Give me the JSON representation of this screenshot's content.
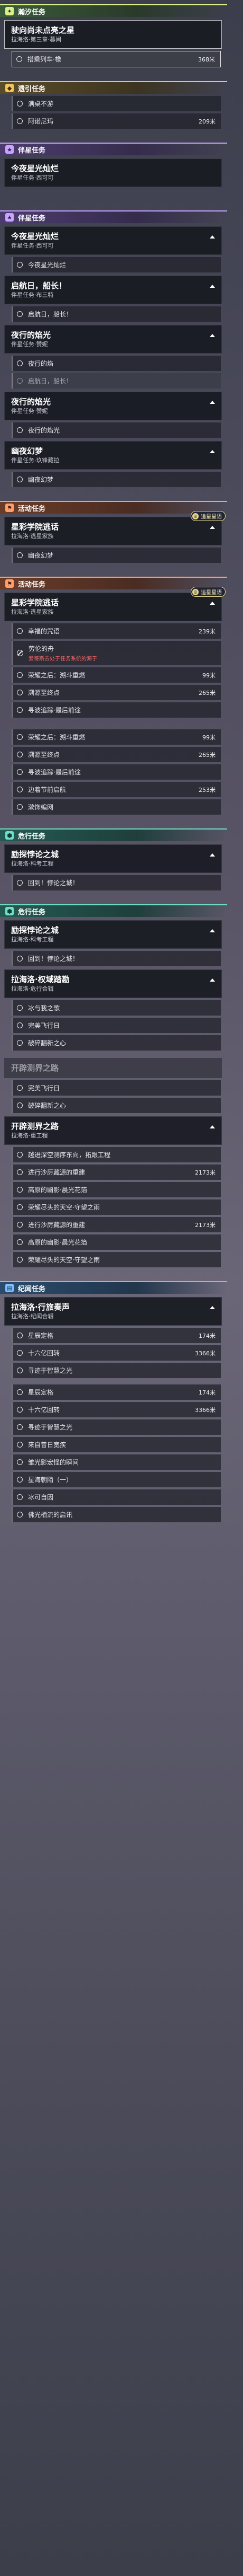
{
  "s0_cat": {
    "label": "瀚汐任务",
    "icon": "spark-icon",
    "accent": "#d9f08c"
  },
  "s0_q0": {
    "title": "驶向尚未点亮之星",
    "sub": "拉海洛·第三章·暮间"
  },
  "s0_q0_t0": {
    "text": "搭乘列车·橡",
    "dist": "368米"
  },
  "s1_cat": {
    "label": "遗引任务",
    "icon": "pin-icon",
    "accent": "#f2c45c"
  },
  "s1_t0": {
    "text": "满桌不游",
    "dist": ""
  },
  "s1_t1": {
    "text": "阿诺尼玛",
    "dist": "209米"
  },
  "s2_cat": {
    "label": "伴星任务",
    "icon": "star-icon",
    "accent": "#c8a4ff"
  },
  "s2_q0": {
    "title": "今夜星光灿烂",
    "sub": "伴星任务·西可可"
  },
  "s3_cat": {
    "label": "伴星任务",
    "icon": "star-icon",
    "accent": "#c8a4ff"
  },
  "s3_q0": {
    "title": "今夜星光灿烂",
    "sub": "伴星任务·西可可"
  },
  "s3_q0_t0": {
    "text": "今夜星光灿烂"
  },
  "s3_q1": {
    "title": "启航日，船长！",
    "sub": "伴星任务·布三特"
  },
  "s3_q1_t0": {
    "text": "启航日，船长！"
  },
  "s3_q2": {
    "title": "夜行的焰光",
    "sub": "伴星任务·赞妮"
  },
  "s3_q2_t0": {
    "text": "夜行的焰"
  },
  "s3_q2_t1": {
    "text": "启航日，船长！"
  },
  "s3_q3": {
    "title": "夜行的焰光",
    "sub": "伴星任务·赞妮"
  },
  "s3_q3_t0": {
    "text": "夜行的焰光"
  },
  "s3_q4": {
    "title": "幽夜幻梦",
    "sub": "伴星任务·玖锋藏拉"
  },
  "s3_q4_t0": {
    "text": "幽夜幻梦"
  },
  "s4_cat": {
    "label": "活动任务",
    "icon": "flag-icon",
    "accent": "#ff9e6a"
  },
  "s4_q0": {
    "title": "星彩学院逃话",
    "sub": "拉海洛·逃星家族",
    "track": "追星星语"
  },
  "s4_q0_t0": {
    "text": "幽夜幻梦"
  },
  "s5_cat": {
    "label": "活动任务",
    "icon": "flag-icon",
    "accent": "#ff9e6a"
  },
  "s5_q0": {
    "title": "星彩学院逃话",
    "sub": "拉海洛·逃星家族",
    "track": "追星星语"
  },
  "s5_q0_t0": {
    "text": "幸福的咒语",
    "dist": "239米"
  },
  "s5_q0_t1": {
    "text": "劳伦的舟",
    "warn": "爱哥斯去处于任务系统的源于"
  },
  "s5_q0_t2": {
    "text": "荣耀之后：溯斗重燃",
    "dist": "99米"
  },
  "s5_q0_t3": {
    "text": "溯源至终点",
    "dist": "265米"
  },
  "s5_q0_t4": {
    "text": "寻波追踪·最后前途"
  },
  "s5_q0_t5": {
    "text": "荣耀之后：溯斗重燃",
    "dist": "99米"
  },
  "s5_q0_t6": {
    "text": "溯源至终点",
    "dist": "265米"
  },
  "s5_q0_t7": {
    "text": "寻波追踪·最后前途"
  },
  "s5_q0_t8": {
    "text": "边着节前启航",
    "dist": "253米"
  },
  "s5_q0_t9": {
    "text": "漱饰编网"
  },
  "s6_cat": {
    "label": "危行任务",
    "icon": "shield-icon",
    "accent": "#6fe0c8"
  },
  "s6_q0": {
    "title": "励探悖论之城",
    "sub": "拉海洛·科考工程"
  },
  "s6_q0_t0": {
    "text": "回到！悖论之城！"
  },
  "s7_cat": {
    "label": "危行任务",
    "icon": "shield-icon",
    "accent": "#6fe0c8"
  },
  "s7_q0": {
    "title": "励探悖论之城",
    "sub": "拉海洛·科考工程"
  },
  "s7_q0_t0": {
    "text": "回到！悖论之城！"
  },
  "s7_q1": {
    "title": "拉海洛·权域踏勘",
    "sub": "拉海洛·危行合辑"
  },
  "s7_q1_t0": {
    "text": "冰与我之歌"
  },
  "s7_q1_t1": {
    "text": "完美飞行日"
  },
  "s7_q1_t2": {
    "text": "破碎翻新之心"
  },
  "s8_q0": {
    "title": "开辟测界之路",
    "sub": ""
  },
  "s8_q0_t0": {
    "text": "完美飞行日"
  },
  "s8_q0_t1": {
    "text": "破碎翻新之心"
  },
  "s8_q1": {
    "title": "开辟测界之路",
    "sub": "拉海洛·重工程"
  },
  "s8_q1_t0": {
    "text": "越进深空测序东向，拓跟工程"
  },
  "s8_q1_t1": {
    "text": "进行沙厉藏源的重建",
    "dist": "2173米"
  },
  "s8_q1_t2": {
    "text": "高原的幽影·晨光花箔"
  },
  "s8_q1_t3": {
    "text": "荣耀尽头的天空·守望之雨"
  },
  "s8_q1_t4": {
    "text": "进行沙厉藏源的重建",
    "dist": "2173米"
  },
  "s8_q1_t5": {
    "text": "高原的幽影·晨光花箔"
  },
  "s8_q1_t6": {
    "text": "荣耀尽头的天空·守望之雨"
  },
  "s9_cat": {
    "label": "纪闻任务",
    "icon": "book-icon",
    "accent": "#7cc0ff"
  },
  "s9_q0": {
    "title": "拉海洛·行旅奏声",
    "sub": "拉海洛·纪闻合辑"
  },
  "s9_q0_t0": {
    "text": "星辰定格",
    "dist": "174米"
  },
  "s9_q0_t1": {
    "text": "十六亿回转",
    "dist": "3366米"
  },
  "s9_q0_t2": {
    "text": "寻迹于智慧之光"
  },
  "s9_q0_t3": {
    "text": "星辰定格",
    "dist": "174米"
  },
  "s9_q0_t4": {
    "text": "十六亿回转",
    "dist": "3366米"
  },
  "s9_q0_t5": {
    "text": "寻迹于智慧之光"
  },
  "s9_q0_t6": {
    "text": "来自昔日宽疾"
  },
  "s9_q0_t7": {
    "text": "雏光影宏怪的瞬间"
  },
  "s9_q0_t8": {
    "text": "星海朝陌（一）"
  },
  "s9_q0_t9": {
    "text": "冰可自因"
  },
  "s9_q0_t10": {
    "text": "佛光栖流的启讯"
  }
}
